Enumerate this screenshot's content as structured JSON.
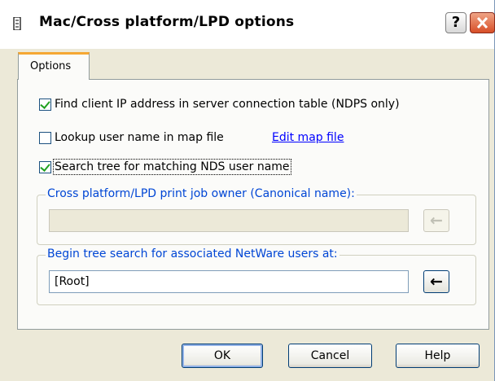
{
  "window": {
    "title": "Mac/Cross platform/LPD options",
    "help_label": "?"
  },
  "tabs": [
    {
      "label": "Options",
      "selected": true
    }
  ],
  "options": {
    "find_client_ip": {
      "label": "Find client IP address in server connection table (NDPS only)",
      "checked": true
    },
    "lookup_user": {
      "label": "Lookup user name in map file",
      "checked": false
    },
    "edit_map_link": "Edit map file",
    "search_tree": {
      "label": "Search tree for matching NDS user name",
      "checked": true
    }
  },
  "groups": {
    "job_owner": {
      "label": "Cross platform/LPD print job owner (Canonical name):",
      "value": "",
      "enabled": false
    },
    "tree_search": {
      "label": "Begin tree search for associated NetWare users at:",
      "value": "[Root]",
      "enabled": true
    }
  },
  "buttons": {
    "ok": "OK",
    "cancel": "Cancel",
    "help": "Help"
  },
  "colors": {
    "group_label": "#0046d5",
    "link": "#0000ff",
    "check": "#21a121",
    "tab_highlight": "#f5a733"
  }
}
